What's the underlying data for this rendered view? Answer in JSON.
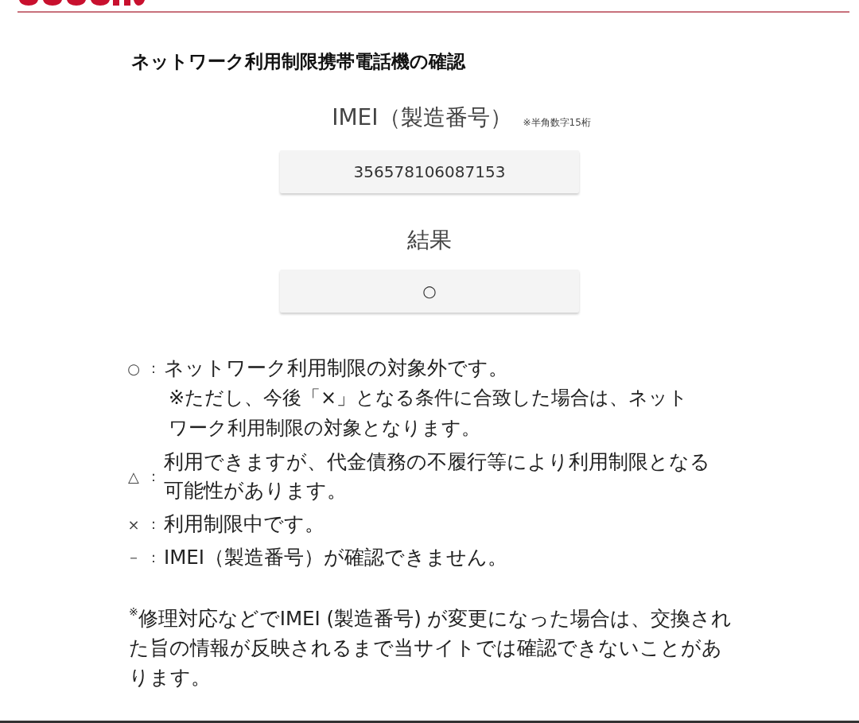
{
  "title": "ネットワーク利用制限携帯電話機の確認",
  "imei": {
    "label": "IMEI（製造番号）",
    "hint": "※半角数字15桁",
    "value": "356578106087153"
  },
  "result": {
    "label": "結果",
    "value": "○"
  },
  "legend": [
    {
      "symbol": "○",
      "sep": "：",
      "lines": [
        "ネットワーク利用制限の対象外です。"
      ],
      "note": [
        "※ただし、今後「×」となる条件に合致した場合は、ネット",
        "ワーク利用制限の対象となります。"
      ]
    },
    {
      "symbol": "△",
      "sep": "：",
      "lines": [
        "利用できますが、代金債務の不履行等により利用制限となる",
        "可能性があります。"
      ]
    },
    {
      "symbol": "×",
      "sep": "：",
      "lines": [
        "利用制限中です。"
      ]
    },
    {
      "symbol": "－",
      "sep": "：",
      "lines": [
        "IMEI（製造番号）が確認できません。"
      ]
    }
  ],
  "footnote": {
    "mark": "※",
    "lines": [
      "修理対応などでIMEI (製造番号) が変更になった場合は、交換され",
      "た旨の情報が反映されるまで当サイトでは確認できないことがあ",
      "ります。"
    ]
  }
}
